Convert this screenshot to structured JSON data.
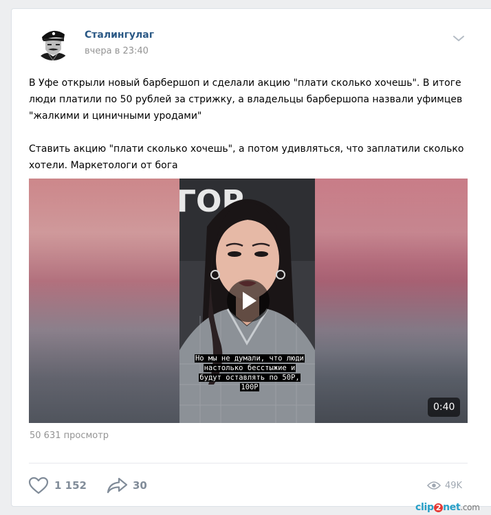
{
  "post": {
    "author": "Сталингулаг",
    "time": "вчера в 23:40",
    "paragraphs": [
      "В Уфе открыли новый барбершоп и сделали акцию \"плати сколько хочешь\". В итоге люди платили по 50 рублей за стрижку, а владельцы барбершопа назвали уфимцев \"жалкими и циничными уродами\"",
      "Ставить акцию \"плати сколько хочешь\", а потом удивляться, что заплатили сколько хотели. Маркетологи от бога"
    ]
  },
  "video": {
    "subtitle_lines": [
      "Но мы не думали, что люди",
      "настолько бесстыжие и",
      "будут оставлять по 50Р,",
      "100Р"
    ],
    "duration": "0:40",
    "backdrop_text": "ГОР"
  },
  "views_text": "50 631 просмотр",
  "actions": {
    "likes": "1 152",
    "shares": "30",
    "views": "49K"
  },
  "watermark": {
    "part1": "clip",
    "badge": "2",
    "part2": "net",
    "part3": ".com"
  },
  "icons": {
    "menu": "chevron-down-icon",
    "like": "heart-icon",
    "share": "share-arrow-icon",
    "views": "eye-icon",
    "play": "play-icon"
  },
  "colors": {
    "author": "#2a5885",
    "muted": "#939393",
    "background": "#edeef0"
  }
}
